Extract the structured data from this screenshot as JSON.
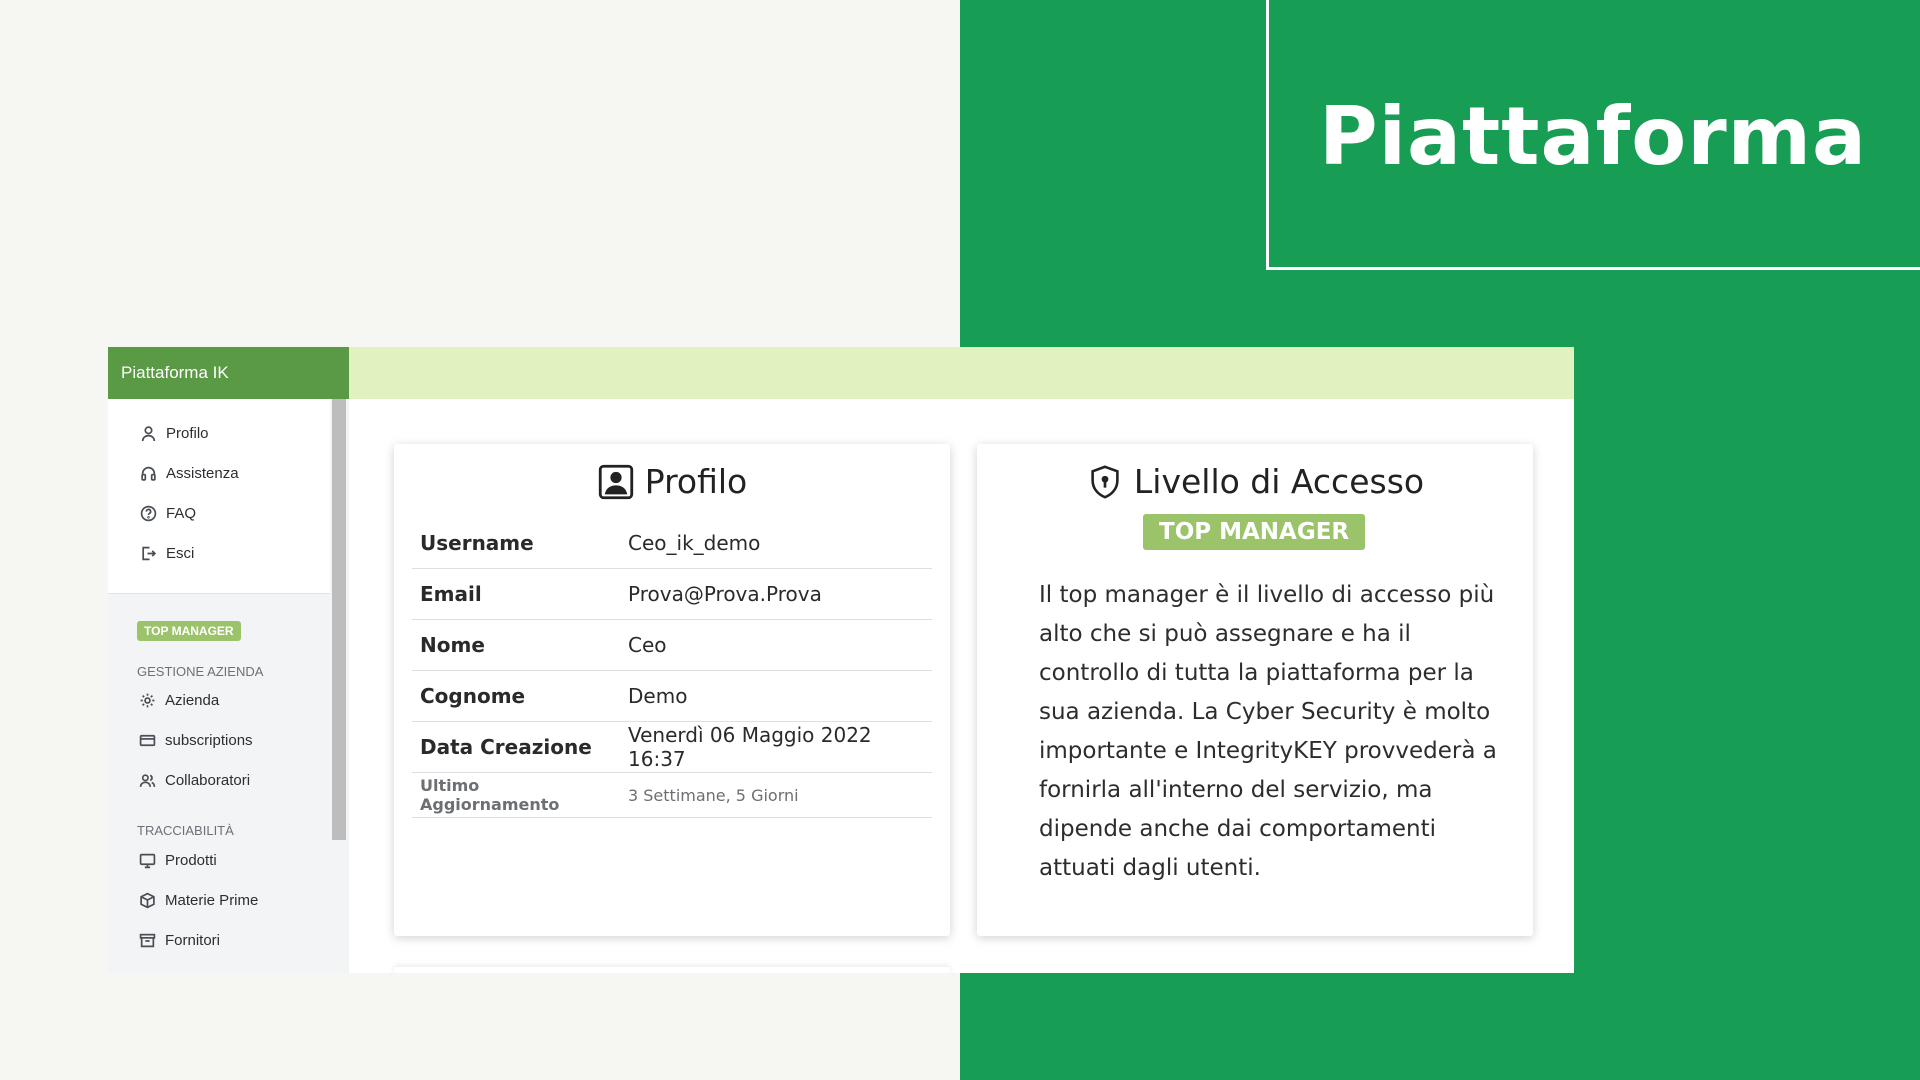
{
  "slide": {
    "title": "Piattaforma"
  },
  "app": {
    "brand": "Piattaforma IK",
    "sidebar": {
      "top_items": [
        {
          "label": "Profilo",
          "icon": "user-icon"
        },
        {
          "label": "Assistenza",
          "icon": "headset-icon"
        },
        {
          "label": "FAQ",
          "icon": "question-icon"
        },
        {
          "label": "Esci",
          "icon": "logout-icon"
        }
      ],
      "role_badge": "TOP MANAGER",
      "sections": [
        {
          "label": "GESTIONE AZIENDA",
          "items": [
            {
              "label": "Azienda",
              "icon": "gear-icon"
            },
            {
              "label": "subscriptions",
              "icon": "credit-card-icon"
            },
            {
              "label": "Collaboratori",
              "icon": "users-icon"
            }
          ]
        },
        {
          "label": "TRACCIABILITÀ",
          "items": [
            {
              "label": "Prodotti",
              "icon": "monitor-icon"
            },
            {
              "label": "Materie Prime",
              "icon": "box-icon"
            },
            {
              "label": "Fornitori",
              "icon": "archive-icon"
            }
          ]
        }
      ]
    },
    "profile_card": {
      "title": "Profilo",
      "rows": [
        {
          "key": "Username",
          "value": "Ceo_ik_demo"
        },
        {
          "key": "Email",
          "value": "Prova@Prova.Prova"
        },
        {
          "key": "Nome",
          "value": "Ceo"
        },
        {
          "key": "Cognome",
          "value": "Demo"
        },
        {
          "key": "Data Creazione",
          "value": "Venerdì 06 Maggio 2022 16:37"
        },
        {
          "key": "Ultimo Aggiornamento",
          "value": "3 Settimane, 5 Giorni"
        }
      ]
    },
    "access_card": {
      "title": "Livello di Accesso",
      "badge": "TOP MANAGER",
      "description": "Il top manager è il livello di accesso più alto che si può assegnare e ha il controllo di tutta la piattaforma per la sua azienda. La Cyber Security è molto importante e IntegrityKEY provvederà a fornirla all'interno del servizio, ma dipende anche dai comportamenti attuati dagli utenti."
    }
  },
  "colors": {
    "slide_green": "#189d54",
    "brand_green": "#5b9a45",
    "header_lime": "#e1f2bf",
    "badge_green": "#9bc36a",
    "background": "#f6f7f2"
  }
}
